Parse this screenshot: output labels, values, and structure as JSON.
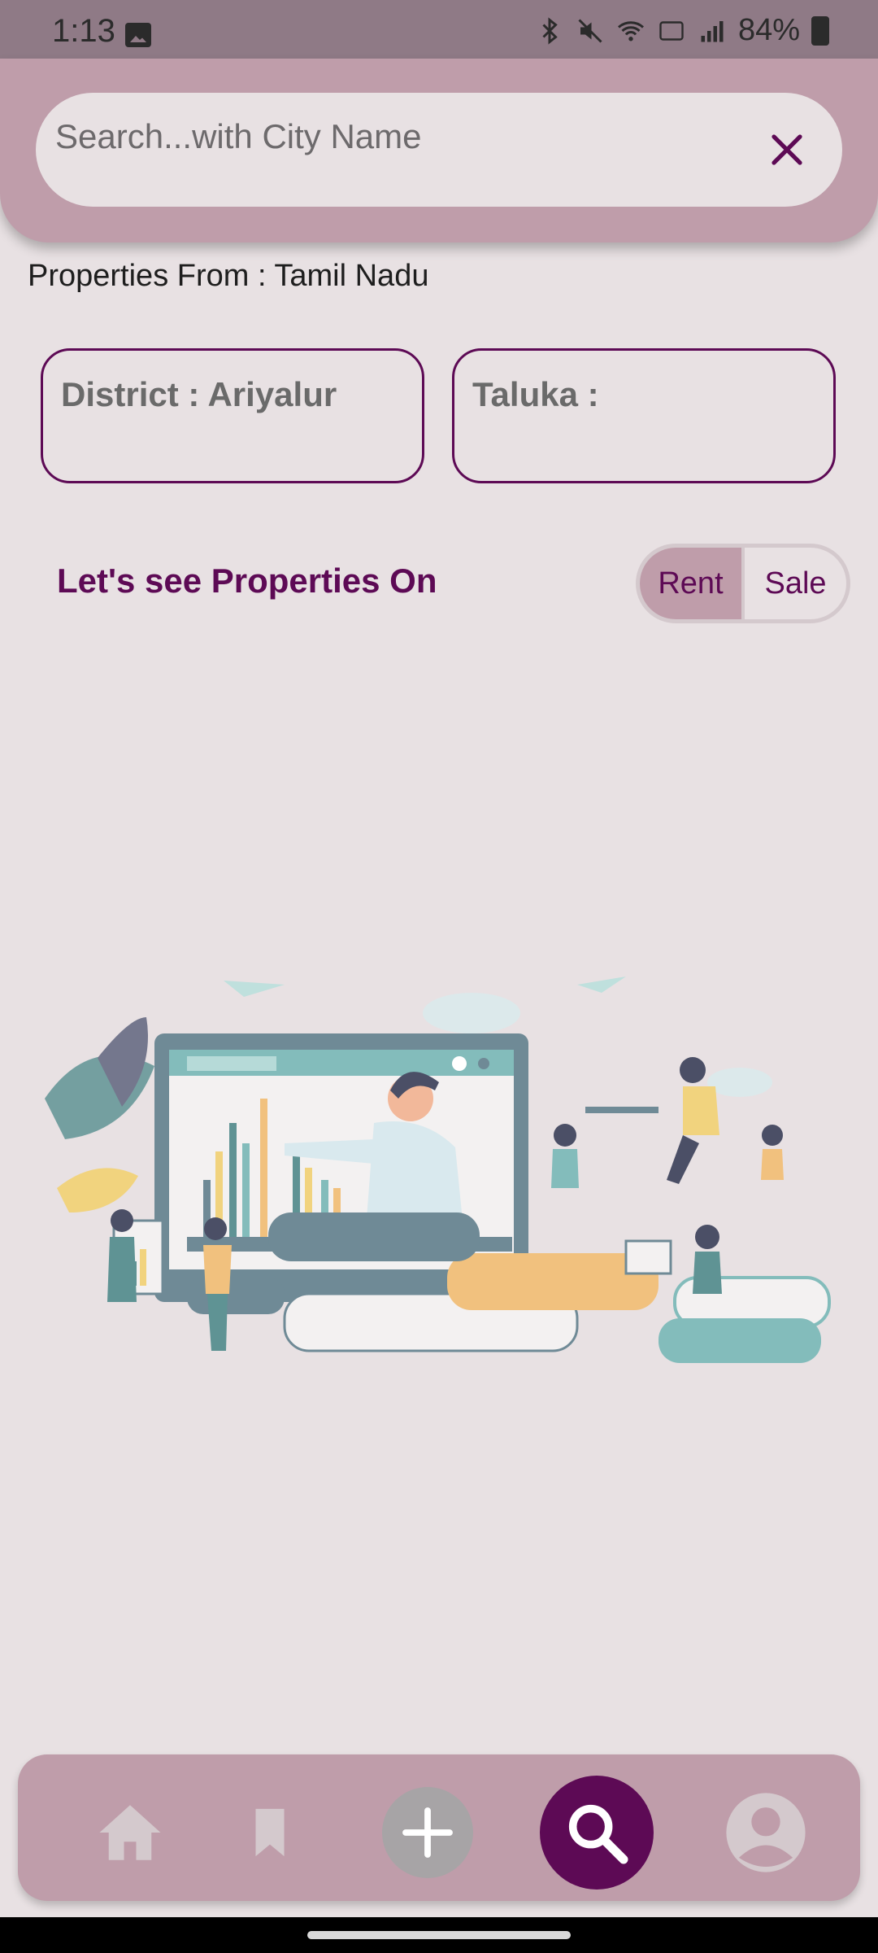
{
  "status_bar": {
    "time": "1:13",
    "battery": "84%",
    "icons": [
      "image-icon",
      "bluetooth-icon",
      "mute-icon",
      "wifi-icon",
      "volte-icon",
      "signal-icon",
      "battery-icon"
    ]
  },
  "search": {
    "placeholder": "Search...with City Name",
    "value": "",
    "clear_icon": "close-icon"
  },
  "properties_from": "Properties From : Tamil Nadu",
  "district_label": "District : Ariyalur",
  "taluka_label": "Taluka :",
  "see_properties_label": "Let's see Properties On",
  "toggle": {
    "options": [
      "Rent",
      "Sale"
    ],
    "selected": "Rent"
  },
  "bottom_nav": {
    "items": [
      "home-icon",
      "bookmark-icon",
      "add-icon",
      "search-icon",
      "profile-icon"
    ],
    "active": "search-icon"
  },
  "colors": {
    "accent": "#5d0a55",
    "header": "#bf9daa",
    "background": "#e8e1e3"
  }
}
